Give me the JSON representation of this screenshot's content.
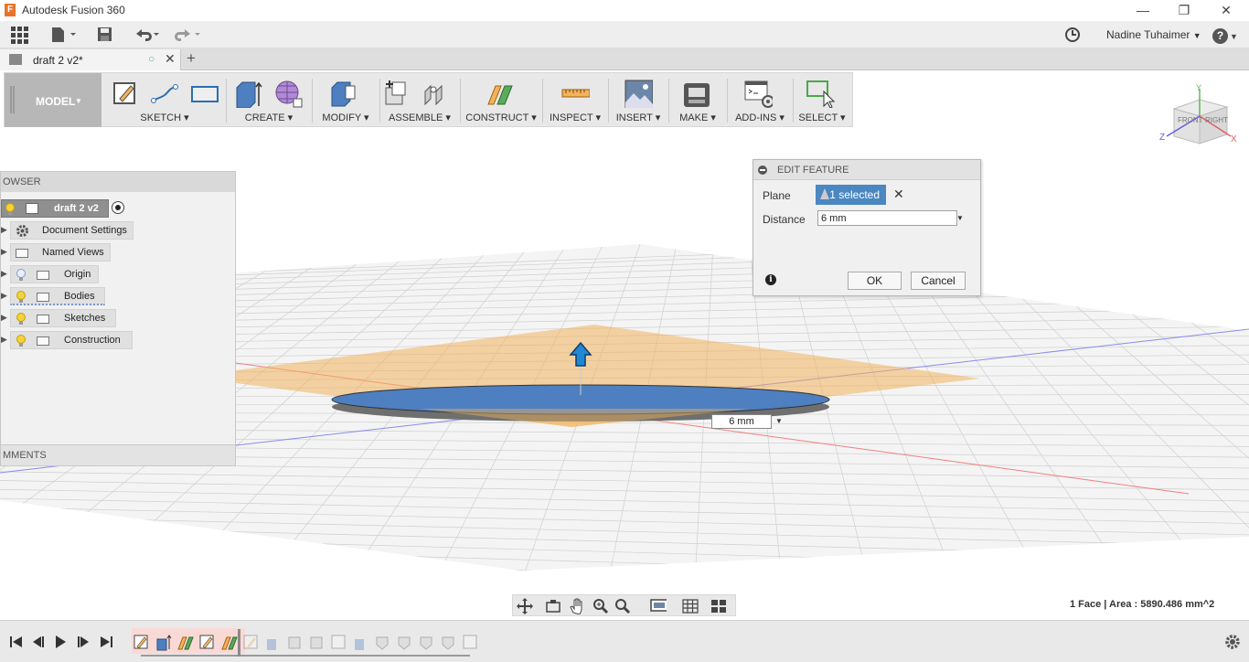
{
  "window": {
    "title": "Autodesk Fusion 360",
    "logo_letter": "F",
    "minimize": "—",
    "restore": "❐",
    "close": "✕"
  },
  "appbar": {
    "user_name": "Nadine Tuhaimer",
    "help": "?"
  },
  "tab": {
    "name": "draft 2 v2*",
    "close": "✕",
    "new": "+"
  },
  "toolbar": {
    "workspace": "MODEL",
    "groups": [
      "SKETCH",
      "CREATE",
      "MODIFY",
      "ASSEMBLE",
      "CONSTRUCT",
      "INSPECT",
      "INSERT",
      "MAKE",
      "ADD-INS",
      "SELECT"
    ]
  },
  "viewcube": {
    "front": "FRONT",
    "right": "RIGHT",
    "x": "X",
    "y": "Y",
    "z": "Z"
  },
  "browser": {
    "header": "OWSER",
    "root": "draft 2 v2",
    "items": [
      "Document Settings",
      "Named Views",
      "Origin",
      "Bodies",
      "Sketches",
      "Construction"
    ],
    "comments": "MMENTS"
  },
  "dialog": {
    "title": "EDIT FEATURE",
    "plane_label": "Plane",
    "plane_value": "1 selected",
    "distance_label": "Distance",
    "distance_value": "6 mm",
    "ok": "OK",
    "cancel": "Cancel",
    "info": "i"
  },
  "canvas": {
    "distance_value": "6 mm"
  },
  "status": {
    "text": "1 Face | Area : 5890.486 mm^2"
  },
  "colors": {
    "plane": "#f2b35c",
    "disc_top": "#4e7fc0",
    "disc_side": "#6f6f6f",
    "arrow": "#1f87d4",
    "selected": "#4b87c1"
  }
}
